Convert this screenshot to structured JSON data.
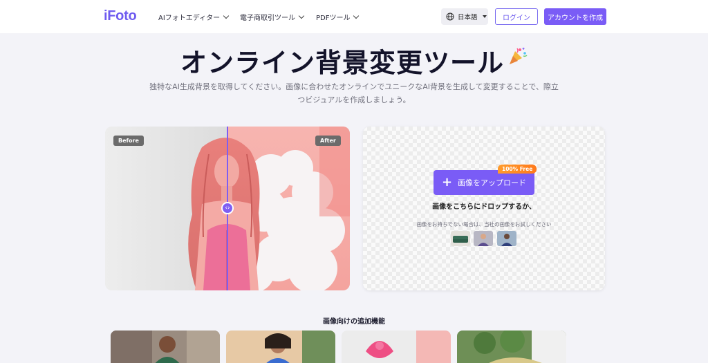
{
  "header": {
    "logo": "iFoto",
    "nav": [
      {
        "label": "AIフォトエディター"
      },
      {
        "label": "電子商取引ツール"
      },
      {
        "label": "PDFツール"
      }
    ],
    "language": "日本語",
    "login_label": "ログイン",
    "signup_label": "アカウントを作成"
  },
  "hero": {
    "title": "オンライン背景変更ツール",
    "subtitle": "独特なAI生成背景を取得してください。画像に合わせたオンラインでユニークなAI背景を生成して変更することで、際立つビジュアルを作成しましょう。"
  },
  "compare": {
    "before_label": "Before",
    "after_label": "After"
  },
  "upload": {
    "button_label": "画像をアップロード",
    "free_badge": "100% Free",
    "drop_text": "画像をこちらにドロップするか、",
    "sample_text": "画像をお持ちでない場合は、当社の画像をお試しください"
  },
  "features": {
    "title": "画像向けの追加機能"
  },
  "colors": {
    "accent": "#7a5cf6",
    "badge": "#ff8a24",
    "background": "#f3f3f8"
  }
}
